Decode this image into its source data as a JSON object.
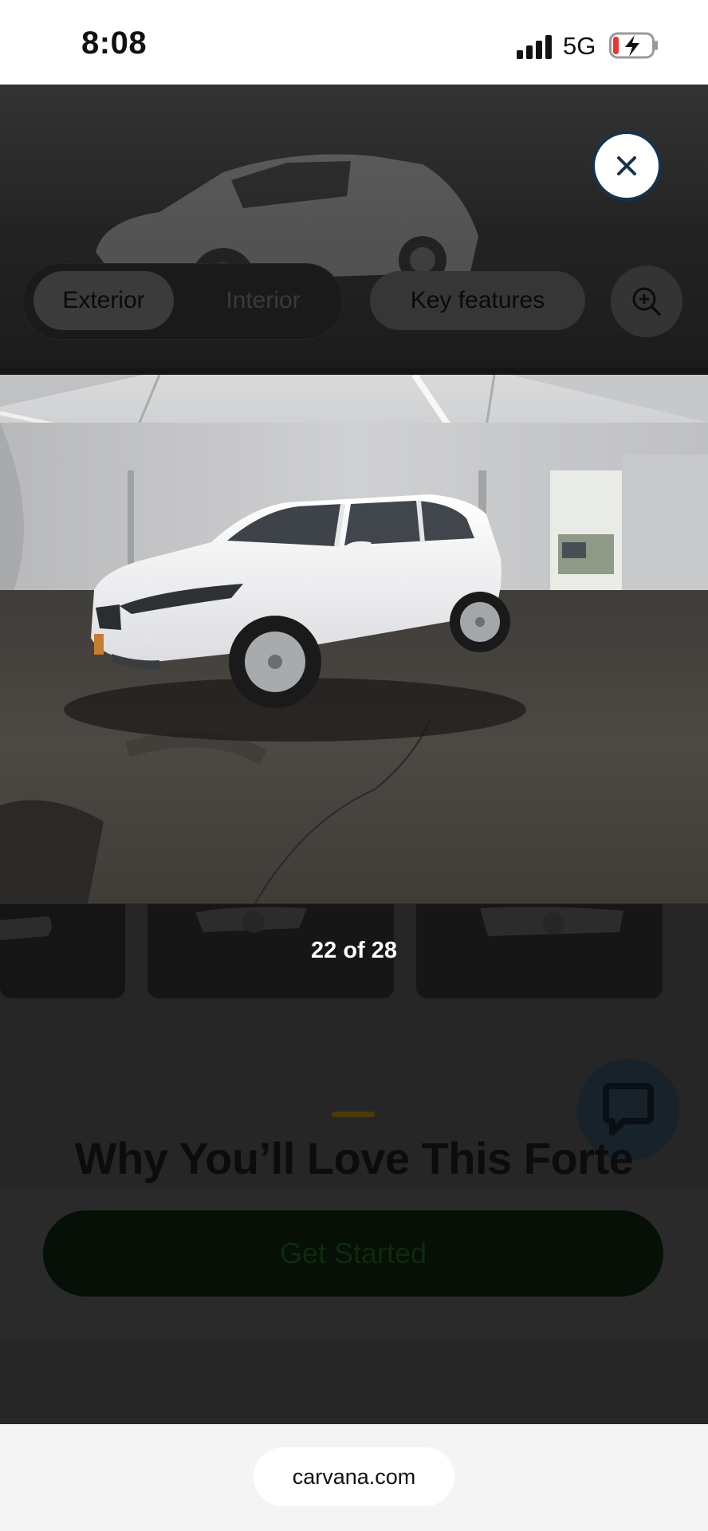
{
  "status_bar": {
    "time": "8:08",
    "network": "5G",
    "signal_icon": "cellular-signal-icon",
    "battery_icon": "battery-charging-icon"
  },
  "gallery": {
    "close_icon": "close-icon",
    "tabs": [
      {
        "label": "Exterior",
        "selected": true
      },
      {
        "label": "Interior",
        "selected": false
      },
      {
        "label": "Key features",
        "selected": false
      }
    ],
    "zoom_icon": "zoom-in-icon",
    "counter": "22 of 28"
  },
  "page": {
    "section_title": "Why You’ll Love This Forte",
    "chat_icon": "chat-bubble-icon",
    "cta_label": "Get Started",
    "colors": {
      "overlay": "#262626",
      "close_border": "#16324f",
      "cta": "#0a3d0f",
      "accent": "#f2b705"
    }
  },
  "browser": {
    "url": "carvana.com"
  }
}
